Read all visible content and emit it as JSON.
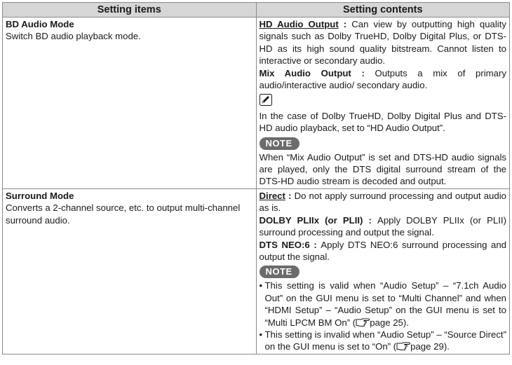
{
  "header": {
    "col1": "Setting items",
    "col2": "Setting contents"
  },
  "rows": [
    {
      "name": "BD Audio Mode",
      "desc": "Switch BD audio playback mode.",
      "items": [
        {
          "term": "HD Audio Output",
          "sep": " : ",
          "text": "Can view by outputting high quality signals such as Dolby TrueHD, Dolby Digital Plus, or DTS-HD as its high sound quality bitstream. Cannot listen to interactive or secondary audio."
        },
        {
          "term": "Mix Audio Output",
          "sep": " : ",
          "text": "Outputs a mix of primary audio/interactive audio/ secondary audio."
        }
      ],
      "memo_icon": "pencil-memo-icon",
      "memo_text": "In the case of Dolby TrueHD, Dolby Digital Plus and DTS-HD audio playback, set to “HD Audio Output”.",
      "note_label": "NOTE",
      "note_text": "When “Mix Audio Output” is set and DTS-HD audio signals are played, only the DTS digital surround stream of the DTS-HD audio stream is decoded and output."
    },
    {
      "name": "Surround Mode",
      "desc": "Converts a 2-channel source, etc. to output multi-channel surround audio.",
      "items": [
        {
          "term": "Direct",
          "sep": " : ",
          "text": "Do not apply surround processing and output audio as is."
        },
        {
          "term": "DOLBY PLIIx (or PLII)",
          "sep": " : ",
          "text": "Apply DOLBY PLIIx (or PLII) surround processing and output the signal."
        },
        {
          "term": "DTS NEO:6",
          "sep": " : ",
          "text": "Apply DTS NEO:6 surround processing and output the signal."
        }
      ],
      "note_label": "NOTE",
      "bullets": [
        {
          "text": "This setting is valid when “Audio Setup” – “7.1ch Audio Out” on the GUI menu is set to “Multi Channel” and when “HDMI Setup” – “Audio Setup” on the GUI menu is set to “Multi LPCM BM On” (",
          "icon": "pointing-hand-icon",
          "ref": "page 25",
          "tail": ")."
        },
        {
          "text": "This setting is invalid when “Audio Setup” – “Source Direct” on the GUI menu is set to “On” (",
          "icon": "pointing-hand-icon",
          "ref": "page 29",
          "tail": ")."
        }
      ]
    }
  ]
}
